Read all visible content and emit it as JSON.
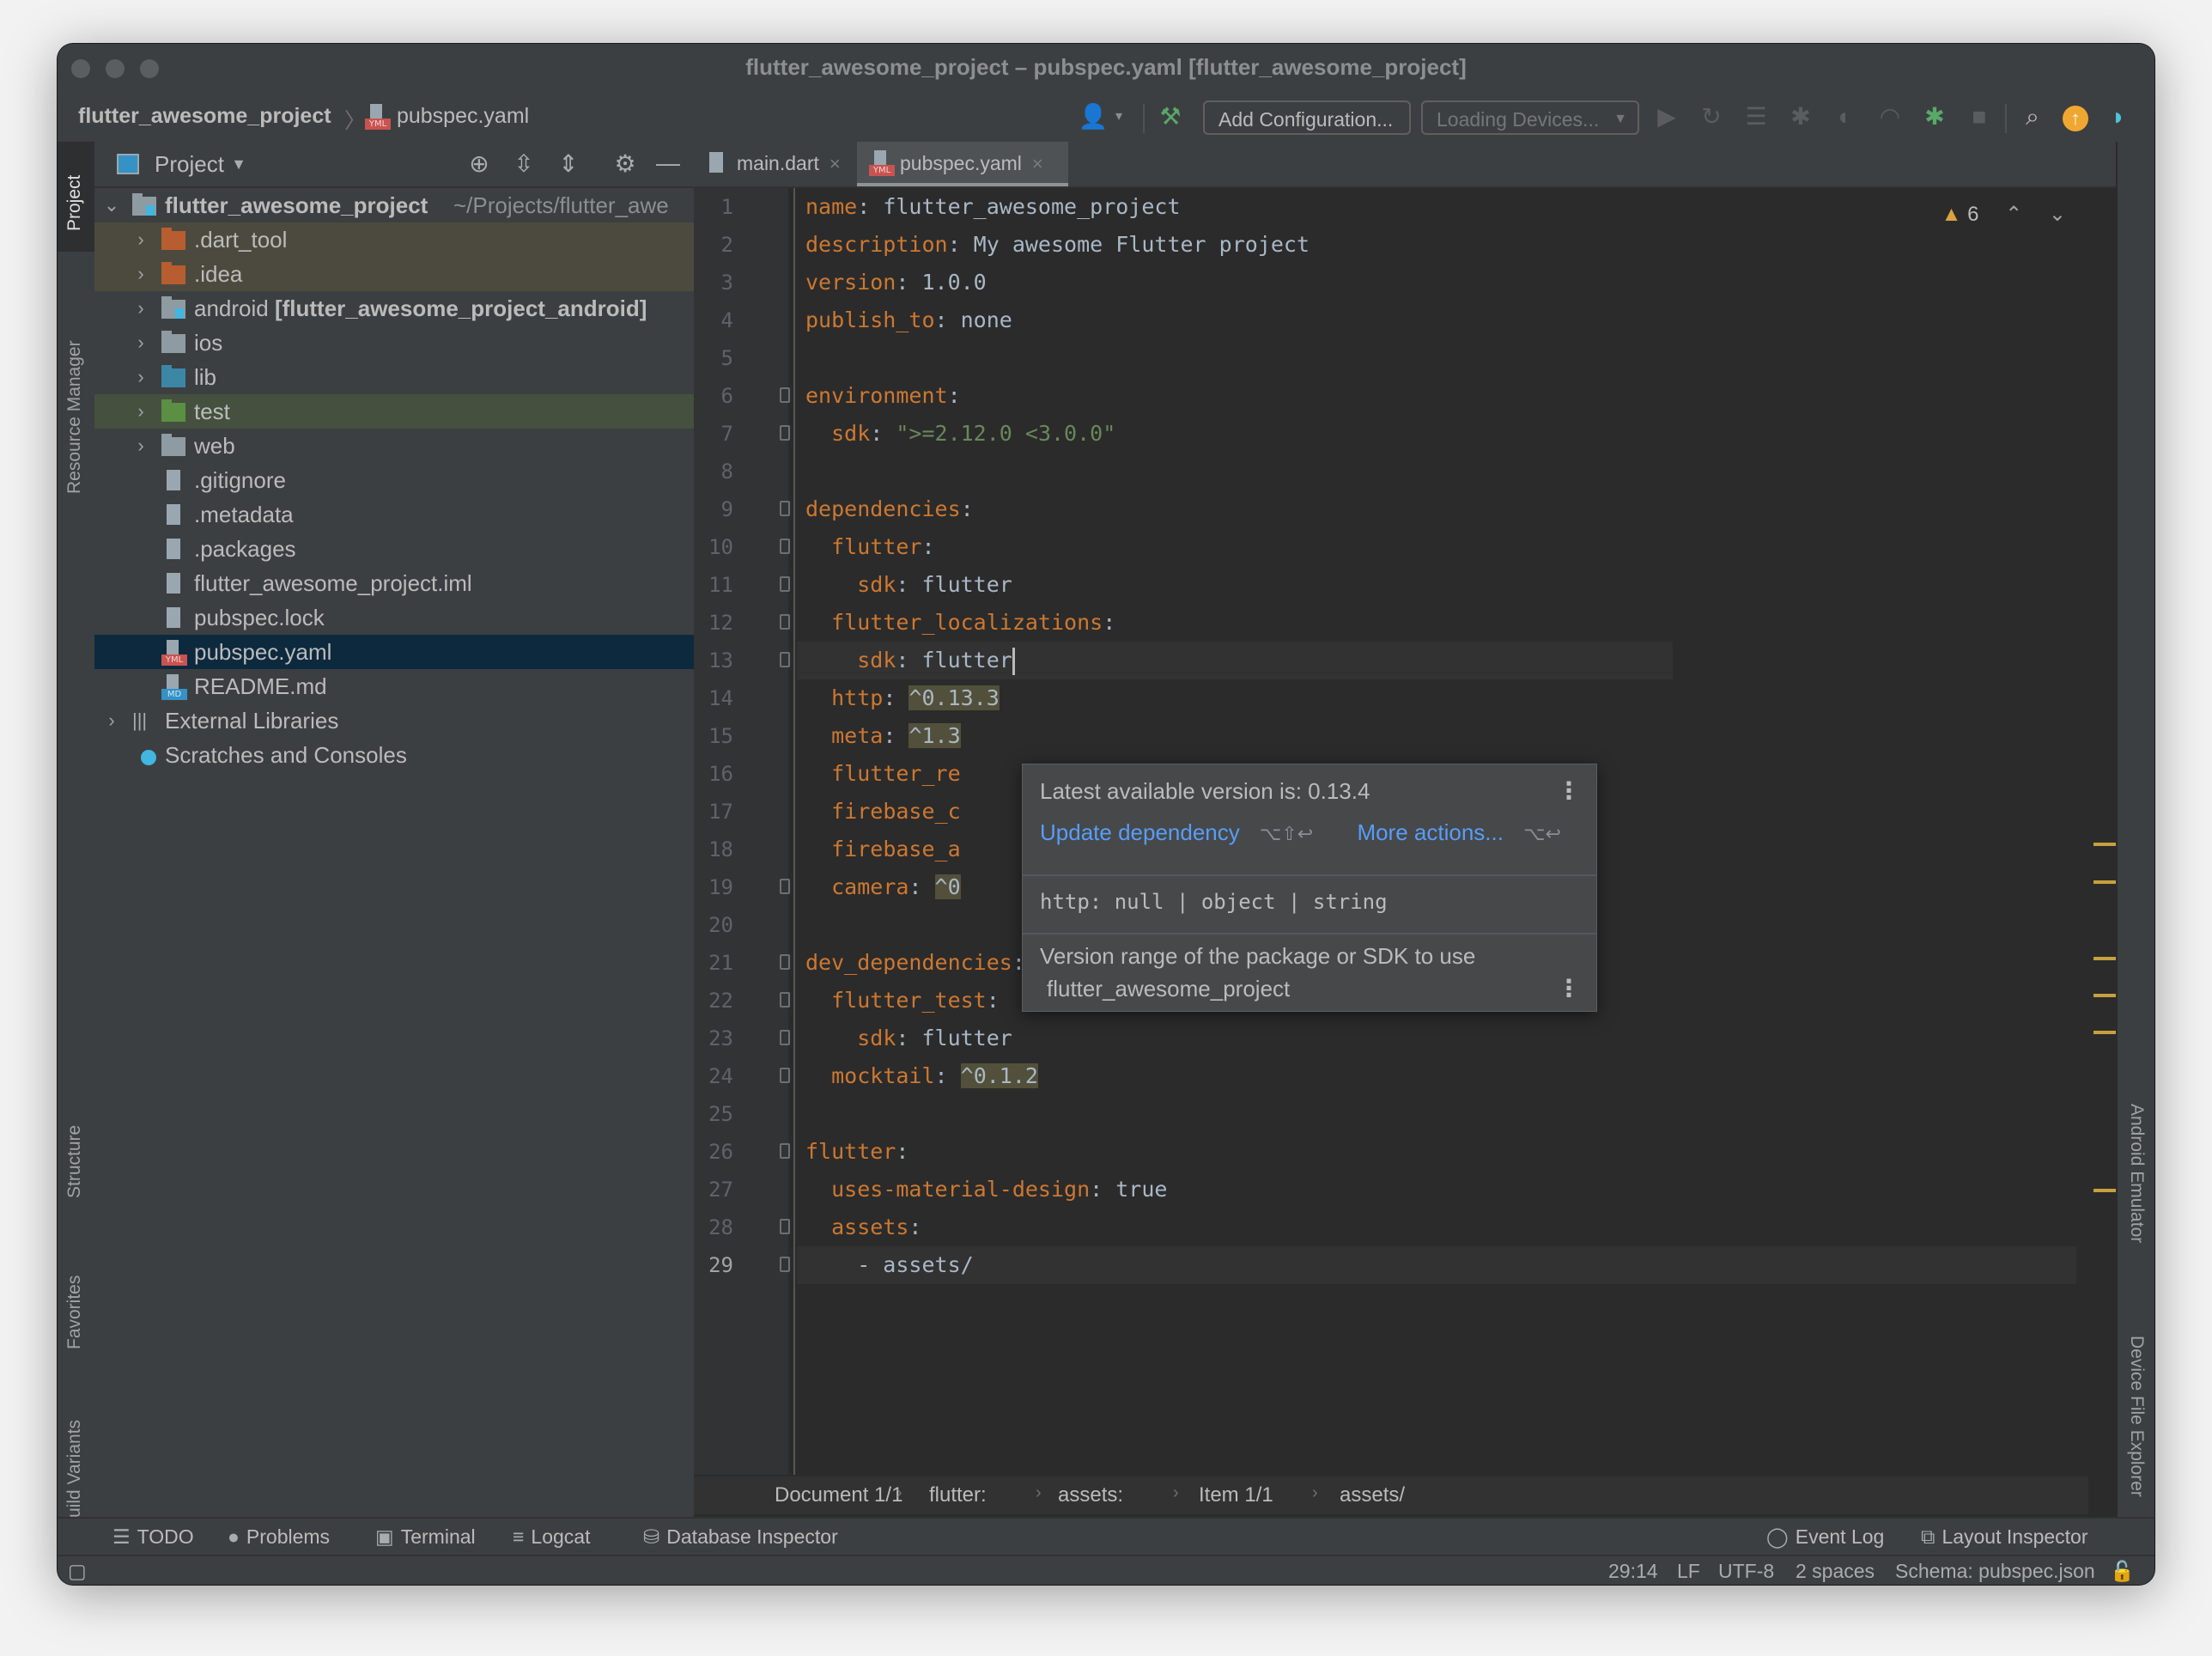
{
  "window": {
    "title": "flutter_awesome_project – pubspec.yaml [flutter_awesome_project]"
  },
  "navbar": {
    "breadcrumb_project": "flutter_awesome_project",
    "breadcrumb_file": "pubspec.yaml",
    "add_configuration": "Add Configuration...",
    "devices": "Loading Devices...",
    "icons": [
      "user-icon",
      "build-hammer-icon",
      "run-icon",
      "apply-changes-icon",
      "apply-code-changes-icon",
      "debug-icon",
      "profile-icon",
      "attach-debugger-icon",
      "attach-green-icon",
      "stop-icon",
      "search-icon",
      "update-icon",
      "flutter-logo-icon"
    ]
  },
  "left_strip": {
    "tabs": [
      "Project",
      "Resource Manager",
      "Structure",
      "Favorites",
      "Build Variants"
    ]
  },
  "project_panel": {
    "title": "Project",
    "tree": [
      {
        "label": "flutter_awesome_project",
        "hint": "~/Projects/flutter_awe",
        "type": "module",
        "depth": 0,
        "expanded": true
      },
      {
        "label": ".dart_tool",
        "type": "folder-excluded",
        "depth": 1
      },
      {
        "label": ".idea",
        "type": "folder-excluded",
        "depth": 1
      },
      {
        "label": "android",
        "bold_suffix": "[flutter_awesome_project_android]",
        "type": "module",
        "depth": 1
      },
      {
        "label": "ios",
        "type": "folder",
        "depth": 1
      },
      {
        "label": "lib",
        "type": "folder-source",
        "depth": 1
      },
      {
        "label": "test",
        "type": "folder-test",
        "depth": 1
      },
      {
        "label": "web",
        "type": "folder",
        "depth": 1
      },
      {
        "label": ".gitignore",
        "type": "file",
        "depth": 1
      },
      {
        "label": ".metadata",
        "type": "file",
        "depth": 1
      },
      {
        "label": ".packages",
        "type": "file",
        "depth": 1
      },
      {
        "label": "flutter_awesome_project.iml",
        "type": "file",
        "depth": 1
      },
      {
        "label": "pubspec.lock",
        "type": "file",
        "depth": 1
      },
      {
        "label": "pubspec.yaml",
        "type": "yaml",
        "depth": 1,
        "selected": true
      },
      {
        "label": "README.md",
        "type": "markdown",
        "depth": 1
      },
      {
        "label": "External Libraries",
        "type": "libraries",
        "depth": 0
      },
      {
        "label": "Scratches and Consoles",
        "type": "scratches",
        "depth": 0
      }
    ]
  },
  "editor": {
    "tabs": [
      {
        "label": "main.dart",
        "active": false
      },
      {
        "label": "pubspec.yaml",
        "active": true
      }
    ],
    "warning_count": "6",
    "lines": [
      {
        "n": "1",
        "parts": [
          [
            "k",
            "name"
          ],
          [
            "v",
            ": flutter_awesome_project"
          ]
        ]
      },
      {
        "n": "2",
        "parts": [
          [
            "k",
            "description"
          ],
          [
            "v",
            ": My awesome Flutter project"
          ]
        ]
      },
      {
        "n": "3",
        "parts": [
          [
            "k",
            "version"
          ],
          [
            "v",
            ": 1.0.0"
          ]
        ]
      },
      {
        "n": "4",
        "parts": [
          [
            "k",
            "publish_to"
          ],
          [
            "v",
            ": none"
          ]
        ]
      },
      {
        "n": "5",
        "parts": []
      },
      {
        "n": "6",
        "parts": [
          [
            "k",
            "environment"
          ],
          [
            "v",
            ":"
          ]
        ]
      },
      {
        "n": "7",
        "parts": [
          [
            "v",
            "  "
          ],
          [
            "k",
            "sdk"
          ],
          [
            "v",
            ": "
          ],
          [
            "s",
            "\">=2.12.0 <3.0.0\""
          ]
        ]
      },
      {
        "n": "8",
        "parts": []
      },
      {
        "n": "9",
        "parts": [
          [
            "k",
            "dependencies"
          ],
          [
            "v",
            ":"
          ]
        ]
      },
      {
        "n": "10",
        "parts": [
          [
            "v",
            "  "
          ],
          [
            "k",
            "flutter"
          ],
          [
            "v",
            ":"
          ]
        ]
      },
      {
        "n": "11",
        "parts": [
          [
            "v",
            "    "
          ],
          [
            "k",
            "sdk"
          ],
          [
            "v",
            ": flutter"
          ]
        ]
      },
      {
        "n": "12",
        "parts": [
          [
            "v",
            "  "
          ],
          [
            "k",
            "flutter_localizations"
          ],
          [
            "v",
            ":"
          ]
        ]
      },
      {
        "n": "13",
        "parts": [
          [
            "v",
            "    "
          ],
          [
            "k",
            "sdk"
          ],
          [
            "v",
            ": flutter"
          ]
        ]
      },
      {
        "n": "14",
        "parts": [
          [
            "v",
            "  "
          ],
          [
            "k",
            "http"
          ],
          [
            "v",
            ": "
          ],
          [
            "hl",
            "^0.13.3"
          ]
        ]
      },
      {
        "n": "15",
        "parts": [
          [
            "v",
            "  "
          ],
          [
            "k",
            "meta"
          ],
          [
            "v",
            ": "
          ],
          [
            "hl",
            "^1.3"
          ]
        ]
      },
      {
        "n": "16",
        "parts": [
          [
            "v",
            "  "
          ],
          [
            "k",
            "flutter_re"
          ]
        ]
      },
      {
        "n": "17",
        "parts": [
          [
            "v",
            "  "
          ],
          [
            "k",
            "firebase_c"
          ]
        ]
      },
      {
        "n": "18",
        "parts": [
          [
            "v",
            "  "
          ],
          [
            "k",
            "firebase_a"
          ]
        ]
      },
      {
        "n": "19",
        "parts": [
          [
            "v",
            "  "
          ],
          [
            "k",
            "camera"
          ],
          [
            "v",
            ": "
          ],
          [
            "hl",
            "^0"
          ]
        ]
      },
      {
        "n": "20",
        "parts": []
      },
      {
        "n": "21",
        "parts": [
          [
            "k",
            "dev_dependencies"
          ],
          [
            "v",
            ":"
          ]
        ]
      },
      {
        "n": "22",
        "parts": [
          [
            "v",
            "  "
          ],
          [
            "k",
            "flutter_test"
          ],
          [
            "v",
            ":"
          ]
        ]
      },
      {
        "n": "23",
        "parts": [
          [
            "v",
            "    "
          ],
          [
            "k",
            "sdk"
          ],
          [
            "v",
            ": flutter"
          ]
        ]
      },
      {
        "n": "24",
        "parts": [
          [
            "v",
            "  "
          ],
          [
            "k",
            "mocktail"
          ],
          [
            "v",
            ": "
          ],
          [
            "hl",
            "^0.1.2"
          ]
        ]
      },
      {
        "n": "25",
        "parts": []
      },
      {
        "n": "26",
        "parts": [
          [
            "k",
            "flutter"
          ],
          [
            "v",
            ":"
          ]
        ]
      },
      {
        "n": "27",
        "parts": [
          [
            "v",
            "  "
          ],
          [
            "k",
            "uses-material-design"
          ],
          [
            "v",
            ": true"
          ]
        ]
      },
      {
        "n": "28",
        "parts": [
          [
            "v",
            "  "
          ],
          [
            "k",
            "assets"
          ],
          [
            "v",
            ":"
          ]
        ]
      },
      {
        "n": "29",
        "parts": [
          [
            "v",
            "    - assets/"
          ]
        ]
      }
    ],
    "current_line": "29",
    "colors": {
      "key": "#cc7832",
      "value": "#a9b7c6",
      "string": "#6a8759",
      "warning": "#d9a343",
      "link": "#589df6"
    }
  },
  "popup": {
    "latest": "Latest available version is: 0.13.4",
    "update_action": "Update dependency",
    "update_shortcut": "⌥⇧↩",
    "more_action": "More actions...",
    "more_shortcut": "⌥↩",
    "type_sig": "http: null | object | string",
    "description": "Version range of the package or SDK to use",
    "source": "flutter_awesome_project"
  },
  "breadcrumbs": [
    "Document 1/1",
    "flutter:",
    "assets:",
    "Item 1/1",
    "assets/"
  ],
  "right_strip": {
    "tabs": [
      "Android Emulator",
      "Device File Explorer"
    ]
  },
  "tool_windows": {
    "left": [
      "TODO",
      "Problems",
      "Terminal",
      "Logcat",
      "Database Inspector"
    ],
    "right": [
      "Event Log",
      "Layout Inspector"
    ]
  },
  "status_bar": {
    "position": "29:14",
    "line_sep": "LF",
    "encoding": "UTF-8",
    "indent": "2 spaces",
    "schema": "Schema: pubspec.json"
  }
}
